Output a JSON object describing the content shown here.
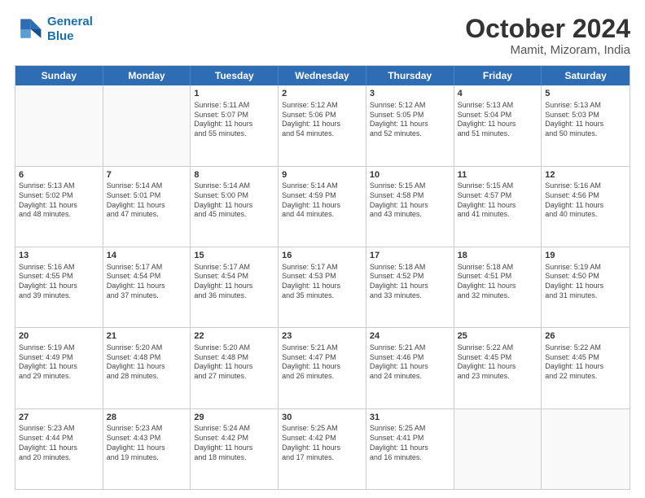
{
  "logo": {
    "text_general": "General",
    "text_blue": "Blue"
  },
  "title": "October 2024",
  "subtitle": "Mamit, Mizoram, India",
  "header_days": [
    "Sunday",
    "Monday",
    "Tuesday",
    "Wednesday",
    "Thursday",
    "Friday",
    "Saturday"
  ],
  "weeks": [
    [
      {
        "day": "",
        "lines": [],
        "empty": true
      },
      {
        "day": "",
        "lines": [],
        "empty": true
      },
      {
        "day": "1",
        "lines": [
          "Sunrise: 5:11 AM",
          "Sunset: 5:07 PM",
          "Daylight: 11 hours",
          "and 55 minutes."
        ]
      },
      {
        "day": "2",
        "lines": [
          "Sunrise: 5:12 AM",
          "Sunset: 5:06 PM",
          "Daylight: 11 hours",
          "and 54 minutes."
        ]
      },
      {
        "day": "3",
        "lines": [
          "Sunrise: 5:12 AM",
          "Sunset: 5:05 PM",
          "Daylight: 11 hours",
          "and 52 minutes."
        ]
      },
      {
        "day": "4",
        "lines": [
          "Sunrise: 5:13 AM",
          "Sunset: 5:04 PM",
          "Daylight: 11 hours",
          "and 51 minutes."
        ]
      },
      {
        "day": "5",
        "lines": [
          "Sunrise: 5:13 AM",
          "Sunset: 5:03 PM",
          "Daylight: 11 hours",
          "and 50 minutes."
        ]
      }
    ],
    [
      {
        "day": "6",
        "lines": [
          "Sunrise: 5:13 AM",
          "Sunset: 5:02 PM",
          "Daylight: 11 hours",
          "and 48 minutes."
        ]
      },
      {
        "day": "7",
        "lines": [
          "Sunrise: 5:14 AM",
          "Sunset: 5:01 PM",
          "Daylight: 11 hours",
          "and 47 minutes."
        ]
      },
      {
        "day": "8",
        "lines": [
          "Sunrise: 5:14 AM",
          "Sunset: 5:00 PM",
          "Daylight: 11 hours",
          "and 45 minutes."
        ]
      },
      {
        "day": "9",
        "lines": [
          "Sunrise: 5:14 AM",
          "Sunset: 4:59 PM",
          "Daylight: 11 hours",
          "and 44 minutes."
        ]
      },
      {
        "day": "10",
        "lines": [
          "Sunrise: 5:15 AM",
          "Sunset: 4:58 PM",
          "Daylight: 11 hours",
          "and 43 minutes."
        ]
      },
      {
        "day": "11",
        "lines": [
          "Sunrise: 5:15 AM",
          "Sunset: 4:57 PM",
          "Daylight: 11 hours",
          "and 41 minutes."
        ]
      },
      {
        "day": "12",
        "lines": [
          "Sunrise: 5:16 AM",
          "Sunset: 4:56 PM",
          "Daylight: 11 hours",
          "and 40 minutes."
        ]
      }
    ],
    [
      {
        "day": "13",
        "lines": [
          "Sunrise: 5:16 AM",
          "Sunset: 4:55 PM",
          "Daylight: 11 hours",
          "and 39 minutes."
        ]
      },
      {
        "day": "14",
        "lines": [
          "Sunrise: 5:17 AM",
          "Sunset: 4:54 PM",
          "Daylight: 11 hours",
          "and 37 minutes."
        ]
      },
      {
        "day": "15",
        "lines": [
          "Sunrise: 5:17 AM",
          "Sunset: 4:54 PM",
          "Daylight: 11 hours",
          "and 36 minutes."
        ]
      },
      {
        "day": "16",
        "lines": [
          "Sunrise: 5:17 AM",
          "Sunset: 4:53 PM",
          "Daylight: 11 hours",
          "and 35 minutes."
        ]
      },
      {
        "day": "17",
        "lines": [
          "Sunrise: 5:18 AM",
          "Sunset: 4:52 PM",
          "Daylight: 11 hours",
          "and 33 minutes."
        ]
      },
      {
        "day": "18",
        "lines": [
          "Sunrise: 5:18 AM",
          "Sunset: 4:51 PM",
          "Daylight: 11 hours",
          "and 32 minutes."
        ]
      },
      {
        "day": "19",
        "lines": [
          "Sunrise: 5:19 AM",
          "Sunset: 4:50 PM",
          "Daylight: 11 hours",
          "and 31 minutes."
        ]
      }
    ],
    [
      {
        "day": "20",
        "lines": [
          "Sunrise: 5:19 AM",
          "Sunset: 4:49 PM",
          "Daylight: 11 hours",
          "and 29 minutes."
        ]
      },
      {
        "day": "21",
        "lines": [
          "Sunrise: 5:20 AM",
          "Sunset: 4:48 PM",
          "Daylight: 11 hours",
          "and 28 minutes."
        ]
      },
      {
        "day": "22",
        "lines": [
          "Sunrise: 5:20 AM",
          "Sunset: 4:48 PM",
          "Daylight: 11 hours",
          "and 27 minutes."
        ]
      },
      {
        "day": "23",
        "lines": [
          "Sunrise: 5:21 AM",
          "Sunset: 4:47 PM",
          "Daylight: 11 hours",
          "and 26 minutes."
        ]
      },
      {
        "day": "24",
        "lines": [
          "Sunrise: 5:21 AM",
          "Sunset: 4:46 PM",
          "Daylight: 11 hours",
          "and 24 minutes."
        ]
      },
      {
        "day": "25",
        "lines": [
          "Sunrise: 5:22 AM",
          "Sunset: 4:45 PM",
          "Daylight: 11 hours",
          "and 23 minutes."
        ]
      },
      {
        "day": "26",
        "lines": [
          "Sunrise: 5:22 AM",
          "Sunset: 4:45 PM",
          "Daylight: 11 hours",
          "and 22 minutes."
        ]
      }
    ],
    [
      {
        "day": "27",
        "lines": [
          "Sunrise: 5:23 AM",
          "Sunset: 4:44 PM",
          "Daylight: 11 hours",
          "and 20 minutes."
        ]
      },
      {
        "day": "28",
        "lines": [
          "Sunrise: 5:23 AM",
          "Sunset: 4:43 PM",
          "Daylight: 11 hours",
          "and 19 minutes."
        ]
      },
      {
        "day": "29",
        "lines": [
          "Sunrise: 5:24 AM",
          "Sunset: 4:42 PM",
          "Daylight: 11 hours",
          "and 18 minutes."
        ]
      },
      {
        "day": "30",
        "lines": [
          "Sunrise: 5:25 AM",
          "Sunset: 4:42 PM",
          "Daylight: 11 hours",
          "and 17 minutes."
        ]
      },
      {
        "day": "31",
        "lines": [
          "Sunrise: 5:25 AM",
          "Sunset: 4:41 PM",
          "Daylight: 11 hours",
          "and 16 minutes."
        ]
      },
      {
        "day": "",
        "lines": [],
        "empty": true
      },
      {
        "day": "",
        "lines": [],
        "empty": true
      }
    ]
  ]
}
